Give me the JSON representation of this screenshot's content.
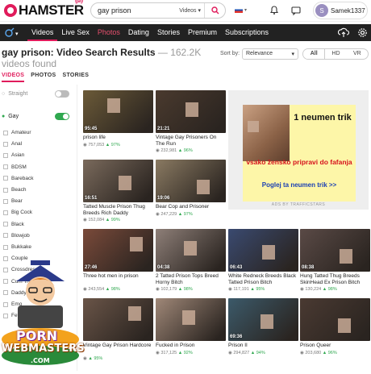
{
  "header": {
    "logo_text": "HAMSTER",
    "logo_tag": "gay",
    "search_value": "gay prison",
    "search_category": "Videos",
    "username": "Samek1337",
    "avatar_letter": "S"
  },
  "nav": {
    "items": [
      "Videos",
      "Live Sex",
      "Photos",
      "Dating",
      "Stories",
      "Premium",
      "Subscriptions"
    ]
  },
  "results": {
    "title": "gay prison: Video Search Results",
    "count": "162.2K videos found",
    "sort_label": "Sort by:",
    "sort_value": "Relevance",
    "quality": [
      "All",
      "HD",
      "VR"
    ]
  },
  "tabs": [
    "VIDEOS",
    "PHOTOS",
    "STORIES"
  ],
  "filters": {
    "straight_label": "Straight",
    "gay_label": "Gay",
    "categories": [
      "Amateur",
      "Anal",
      "Asian",
      "BDSM",
      "Bareback",
      "Beach",
      "Bear",
      "Big Cock",
      "Black",
      "Blowjob",
      "Bukkake",
      "Couple",
      "Crossdress",
      "Cum Tribute",
      "Daddy",
      "Emo",
      "Fetish"
    ]
  },
  "videos": [
    {
      "title": "prison life",
      "duration": "95:45",
      "views": "757,053",
      "rating": "97%",
      "color": "#6b5a38"
    },
    {
      "title": "Vintage Gay Prisoners On The Run",
      "duration": "21:21",
      "views": "232,981",
      "rating": "96%",
      "color": "#4a3a2e"
    },
    {
      "title": "Tatted Muscle Prison Thug Breeds Rich Daddy",
      "duration": "16:51",
      "views": "152,084",
      "rating": "99%",
      "color": "#7a6a5c"
    },
    {
      "title": "Bear Cop and Prisoner",
      "duration": "19:06",
      "views": "247,229",
      "rating": "97%",
      "color": "#8a7a62"
    },
    {
      "title": "Three hot men in prison",
      "duration": "27:46",
      "views": "243,554",
      "rating": "98%",
      "color": "#7a4a3a"
    },
    {
      "title": "2 Tatted Prison Tops Breed Horny Bitch",
      "duration": "04:38",
      "views": "102,179",
      "rating": "98%",
      "color": "#8e7f78"
    },
    {
      "title": "White Redneck Breeds Black Tatted Prison Bitch",
      "duration": "06:43",
      "views": "117,191",
      "rating": "95%",
      "color": "#3a4a70"
    },
    {
      "title": "Hung Tatted Thug Breeds SkinHead Ex Prison Bitch",
      "duration": "08:38",
      "views": "130,224",
      "rating": "98%",
      "color": "#5a4a46"
    },
    {
      "title": "Vintage Gay Prison Hardcore",
      "duration": "",
      "views": "",
      "rating": "95%",
      "color": "#6a5548"
    },
    {
      "title": "Fucked in Prison",
      "duration": "",
      "views": "317,125",
      "rating": "92%",
      "color": "#a08878"
    },
    {
      "title": "Prison II",
      "duration": "69:36",
      "views": "294,827",
      "rating": "94%",
      "color": "#3c5a6a"
    },
    {
      "title": "Prison Queer",
      "duration": "",
      "views": "203,680",
      "rating": "96%",
      "color": "#4a3a32"
    }
  ],
  "ad": {
    "headline": "1 neumen trik",
    "body": "vsako žensko pripravi do fafanja",
    "link": "Poglej ta neumen trik >>",
    "by": "ADS BY TRAFFICSTARS"
  },
  "mascot": {
    "line1": "PORN",
    "line2": "WEBMASTERS",
    "line3": ".COM"
  },
  "colors": {
    "accent": "#e01b5b",
    "nav_bg": "#222222",
    "toggle_on": "#2fa84f",
    "ad_bg": "#fdf6a8"
  }
}
